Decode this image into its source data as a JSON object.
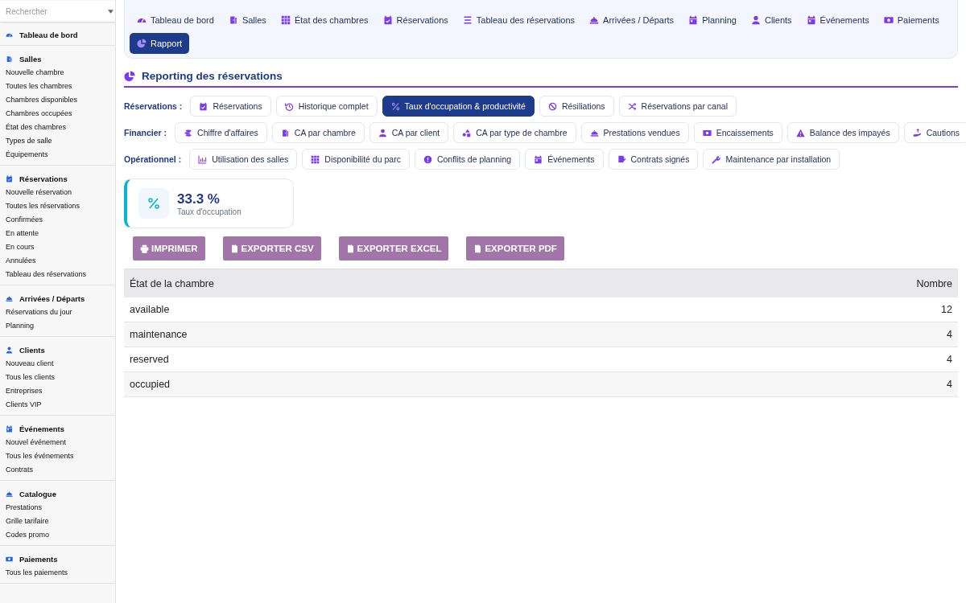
{
  "sidebar": {
    "search": {
      "placeholder": "Rechercher"
    },
    "sections": [
      {
        "title": "Tableau de bord"
      },
      {
        "title": "Salles",
        "items": [
          "Nouvelle chambre",
          "Toutes les chambres",
          "Chambres disponibles",
          "Chambres occupées",
          "État des chambres",
          "Types de salle",
          "Équipements"
        ]
      },
      {
        "title": "Réservations",
        "items": [
          "Nouvelle réservation",
          "Toutes les réservations",
          "Confirmées",
          "En attente",
          "En cours",
          "Annulées",
          "Tableau des réservations"
        ]
      },
      {
        "title": "Arrivées / Départs",
        "items": [
          "Réservations du jour",
          "Planning"
        ]
      },
      {
        "title": "Clients",
        "items": [
          "Nouveau client",
          "Tous les clients",
          "Entreprises",
          "Clients VIP"
        ]
      },
      {
        "title": "Événements",
        "items": [
          "Nouvel événement",
          "Tous les événements",
          "Contrats"
        ]
      },
      {
        "title": "Catalogue",
        "items": [
          "Prestations",
          "Grille tarifaire",
          "Codes promo"
        ]
      },
      {
        "title": "Paiements",
        "items": [
          "Tous les paiements"
        ]
      }
    ]
  },
  "top_nav": [
    {
      "label": "Tableau de bord",
      "selected": false
    },
    {
      "label": "Salles",
      "selected": false
    },
    {
      "label": "État des chambres",
      "selected": false
    },
    {
      "label": "Réservations",
      "selected": false
    },
    {
      "label": "Tableau des réservations",
      "selected": false
    },
    {
      "label": "Arrivées / Départs",
      "selected": false
    },
    {
      "label": "Planning",
      "selected": false
    },
    {
      "label": "Clients",
      "selected": false
    },
    {
      "label": "Événements",
      "selected": false
    },
    {
      "label": "Paiements",
      "selected": false
    },
    {
      "label": "Rapport",
      "selected": true
    }
  ],
  "page_title": "Reporting des réservations",
  "report_groups": [
    {
      "label": "Réservations :",
      "reports": [
        {
          "label": "Réservations",
          "selected": false
        },
        {
          "label": "Historique complet",
          "selected": false
        },
        {
          "label": "Taux d'occupation & productivité",
          "selected": true
        },
        {
          "label": "Résiliations",
          "selected": false
        },
        {
          "label": "Réservations par canal",
          "selected": false
        }
      ]
    },
    {
      "label": "Financier :",
      "reports": [
        {
          "label": "Chiffre d'affaires",
          "selected": false
        },
        {
          "label": "CA par chambre",
          "selected": false
        },
        {
          "label": "CA par client",
          "selected": false
        },
        {
          "label": "CA par type de chambre",
          "selected": false
        },
        {
          "label": "Prestations vendues",
          "selected": false
        },
        {
          "label": "Encaissements",
          "selected": false
        },
        {
          "label": "Balance des impayés",
          "selected": false
        },
        {
          "label": "Cautions",
          "selected": false
        }
      ]
    },
    {
      "label": "Opérationnel :",
      "reports": [
        {
          "label": "Utilisation des salles",
          "selected": false
        },
        {
          "label": "Disponibilité du parc",
          "selected": false
        },
        {
          "label": "Conflits de planning",
          "selected": false
        },
        {
          "label": "Événements",
          "selected": false
        },
        {
          "label": "Contrats signés",
          "selected": false
        },
        {
          "label": "Maintenance par installation",
          "selected": false
        }
      ]
    }
  ],
  "kpi": {
    "value": "33.3 %",
    "label": "Taux d'occupation"
  },
  "export_buttons": [
    "IMPRIMER",
    "EXPORTER CSV",
    "EXPORTER EXCEL",
    "EXPORTER PDF"
  ],
  "table": {
    "columns": [
      "État de la chambre",
      "Nombre"
    ],
    "rows": [
      [
        "available",
        "12"
      ],
      [
        "maintenance",
        "4"
      ],
      [
        "reserved",
        "4"
      ],
      [
        "occupied",
        "4"
      ]
    ]
  }
}
